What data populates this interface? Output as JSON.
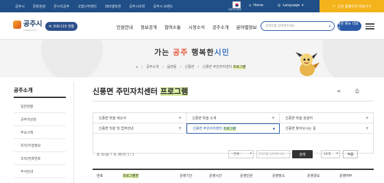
{
  "topbar": {
    "links": [
      "공주시",
      "문화관광",
      "온누리공주",
      "고맙나무장터",
      "365행복센",
      "공주시의회",
      "공주시 브랜드"
    ],
    "gov_label": "대한민국정부",
    "home": "Home",
    "language": "Language",
    "new_site": "신규 홈페이지 바로가기"
  },
  "gnb": {
    "logo_text": "공주시",
    "logo_sub": "GONGJU CITY",
    "covid_label": "코로나19 현황",
    "menu": [
      "민원안내",
      "정보공개",
      "참여소통",
      "시정소식",
      "공주소개",
      "분야별정보"
    ],
    "search_placeholder": "검색어를 입력해주세요",
    "quick_menu": "빠른 메뉴 더보기"
  },
  "visual": {
    "slogan_pre": "가는 ",
    "slogan_accent": "공주",
    "slogan_mid": " 행복한",
    "slogan_post": "시민",
    "breadcrumb": [
      "공주소개",
      "읍면동",
      "신풍면",
      "신풍면 주민자치센터 ",
      "프로그램"
    ]
  },
  "lnb": {
    "title": "공주소개",
    "items": [
      "일반현황",
      "공주의상징",
      "주요시책",
      "위치/지형정보",
      "조직/전화번호",
      "부서안내"
    ]
  },
  "main": {
    "title_pre": "신풍면 주민자치센터 ",
    "title_hl": "프로그램",
    "tabs": [
      "신풍면 마을 새소식",
      "신풍면 마을 소개",
      "신풍면 마을 관광지",
      "신풍면 직원 및 업무안내",
      "신풍면 주민자치센터 ",
      "신풍면 찾아오시는 길"
    ],
    "active_tab_hl": "프로그램",
    "total": "총 게시물 7 개, 페이지 1 / 1",
    "filter_select": "--전체--",
    "filter_placeholder": "검색어를 입력해주세요",
    "filter_button": "검색",
    "page_size": "10개",
    "apply_button": "적용",
    "columns": [
      "번호",
      "프로그램명",
      "운영기간",
      "운영시간",
      "운영인원",
      "운영장소",
      "운영금요",
      "운영여부"
    ]
  }
}
